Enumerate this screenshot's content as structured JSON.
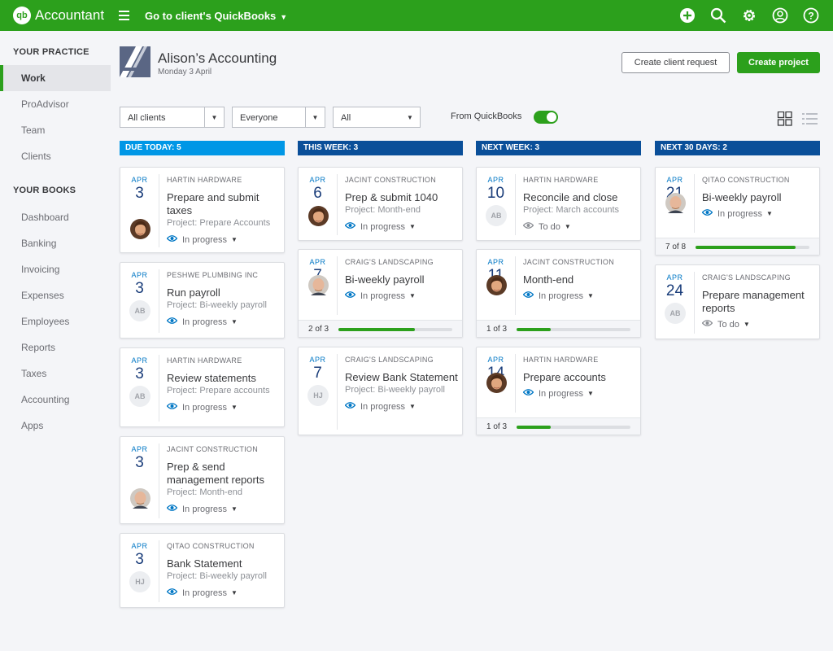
{
  "topbar": {
    "logo_mark": "qb",
    "app_name": "Accountant",
    "goto_label": "Go to client's QuickBooks",
    "icons": [
      "plus-icon",
      "search-icon",
      "gear-icon",
      "user-icon",
      "help-icon"
    ]
  },
  "sidebar": {
    "practice_heading": "YOUR PRACTICE",
    "practice_items": [
      "Work",
      "ProAdvisor",
      "Team",
      "Clients"
    ],
    "books_heading": "YOUR BOOKS",
    "books_items": [
      "Dashboard",
      "Banking",
      "Invoicing",
      "Expenses",
      "Employees",
      "Reports",
      "Taxes",
      "Accounting",
      "Apps"
    ],
    "active": "Work"
  },
  "header": {
    "firm_name": "Alison’s Accounting",
    "date": "Monday 3 April",
    "create_request": "Create client request",
    "create_project": "Create project"
  },
  "filters": {
    "clients": "All clients",
    "people": "Everyone",
    "type": "All",
    "from_qb_label": "From QuickBooks",
    "from_qb_on": true
  },
  "colors": {
    "brand_green": "#2ca01c",
    "due_today": "#0097e6",
    "week_header": "#0a4f99"
  },
  "columns": [
    {
      "title": "DUE TODAY: 5",
      "cards": [
        {
          "month": "APR",
          "day": "3",
          "client": "HARTIN HARDWARE",
          "task": "Prepare and submit taxes",
          "project_label": "Project:",
          "project": "Prepare Accounts",
          "status": "In progress",
          "assignee": "photo-woman",
          "initials": ""
        },
        {
          "month": "APR",
          "day": "3",
          "client": "PESHWE PLUMBING INC",
          "task": "Run payroll",
          "project_label": "Project:",
          "project": "Bi-weekly payroll",
          "status": "In progress",
          "assignee": "",
          "initials": "AB"
        },
        {
          "month": "APR",
          "day": "3",
          "client": "HARTIN HARDWARE",
          "task": "Review statements",
          "project_label": "Project:",
          "project": "Prepare accounts",
          "status": "In progress",
          "assignee": "",
          "initials": "AB"
        },
        {
          "month": "APR",
          "day": "3",
          "client": "JACINT CONSTRUCTION",
          "task": "Prep & send management reports",
          "project_label": "Project:",
          "project": "Month-end",
          "status": "In progress",
          "assignee": "photo-man-bald",
          "initials": ""
        },
        {
          "month": "APR",
          "day": "3",
          "client": "QITAO CONSTRUCTION",
          "task": "Bank Statement",
          "project_label": "Project:",
          "project": "Bi-weekly payroll",
          "status": "In progress",
          "assignee": "",
          "initials": "HJ"
        }
      ]
    },
    {
      "title": "THIS WEEK: 3",
      "cards": [
        {
          "month": "APR",
          "day": "6",
          "client": "JACINT CONSTRUCTION",
          "task": "Prep & submit 1040",
          "project_label": "Project:",
          "project": "Month-end",
          "status": "In progress",
          "assignee": "photo-woman",
          "initials": ""
        },
        {
          "month": "APR",
          "day": "7",
          "client": "CRAIG'S LANDSCAPING",
          "task": "Bi-weekly payroll",
          "project_label": "",
          "project": "",
          "status": "In progress",
          "assignee": "photo-man-bald",
          "initials": "",
          "progress_text": "2 of 3",
          "progress": 0.67
        },
        {
          "month": "APR",
          "day": "7",
          "client": "CRAIG'S LANDSCAPING",
          "task": "Review Bank Statement",
          "project_label": "Project:",
          "project": "Bi-weekly payroll",
          "status": "In progress",
          "assignee": "",
          "initials": "HJ"
        }
      ]
    },
    {
      "title": "NEXT WEEK: 3",
      "cards": [
        {
          "month": "APR",
          "day": "10",
          "client": "HARTIN HARDWARE",
          "task": "Reconcile and close",
          "project_label": "Project:",
          "project": "March accounts",
          "status": "To do",
          "assignee": "",
          "initials": "AB"
        },
        {
          "month": "APR",
          "day": "11",
          "client": "JACINT CONSTRUCTION",
          "task": "Month-end",
          "project_label": "",
          "project": "",
          "status": "In progress",
          "assignee": "photo-woman",
          "initials": "",
          "progress_text": "1 of 3",
          "progress": 0.3
        },
        {
          "month": "APR",
          "day": "14",
          "client": "HARTIN HARDWARE",
          "task": "Prepare accounts",
          "project_label": "",
          "project": "",
          "status": "In progress",
          "assignee": "photo-woman",
          "initials": "",
          "progress_text": "1 of 3",
          "progress": 0.3
        }
      ]
    },
    {
      "title": "NEXT 30 DAYS: 2",
      "cards": [
        {
          "month": "APR",
          "day": "21",
          "client": "QITAO CONSTRUCTION",
          "task": "Bi-weekly payroll",
          "project_label": "",
          "project": "",
          "status": "In progress",
          "assignee": "photo-man-bald",
          "initials": "",
          "progress_text": "7 of 8",
          "progress": 0.88
        },
        {
          "month": "APR",
          "day": "24",
          "client": "CRAIG'S LANDSCAPING",
          "task": "Prepare management reports",
          "project_label": "",
          "project": "",
          "status": "To do",
          "assignee": "",
          "initials": "AB"
        }
      ]
    }
  ]
}
